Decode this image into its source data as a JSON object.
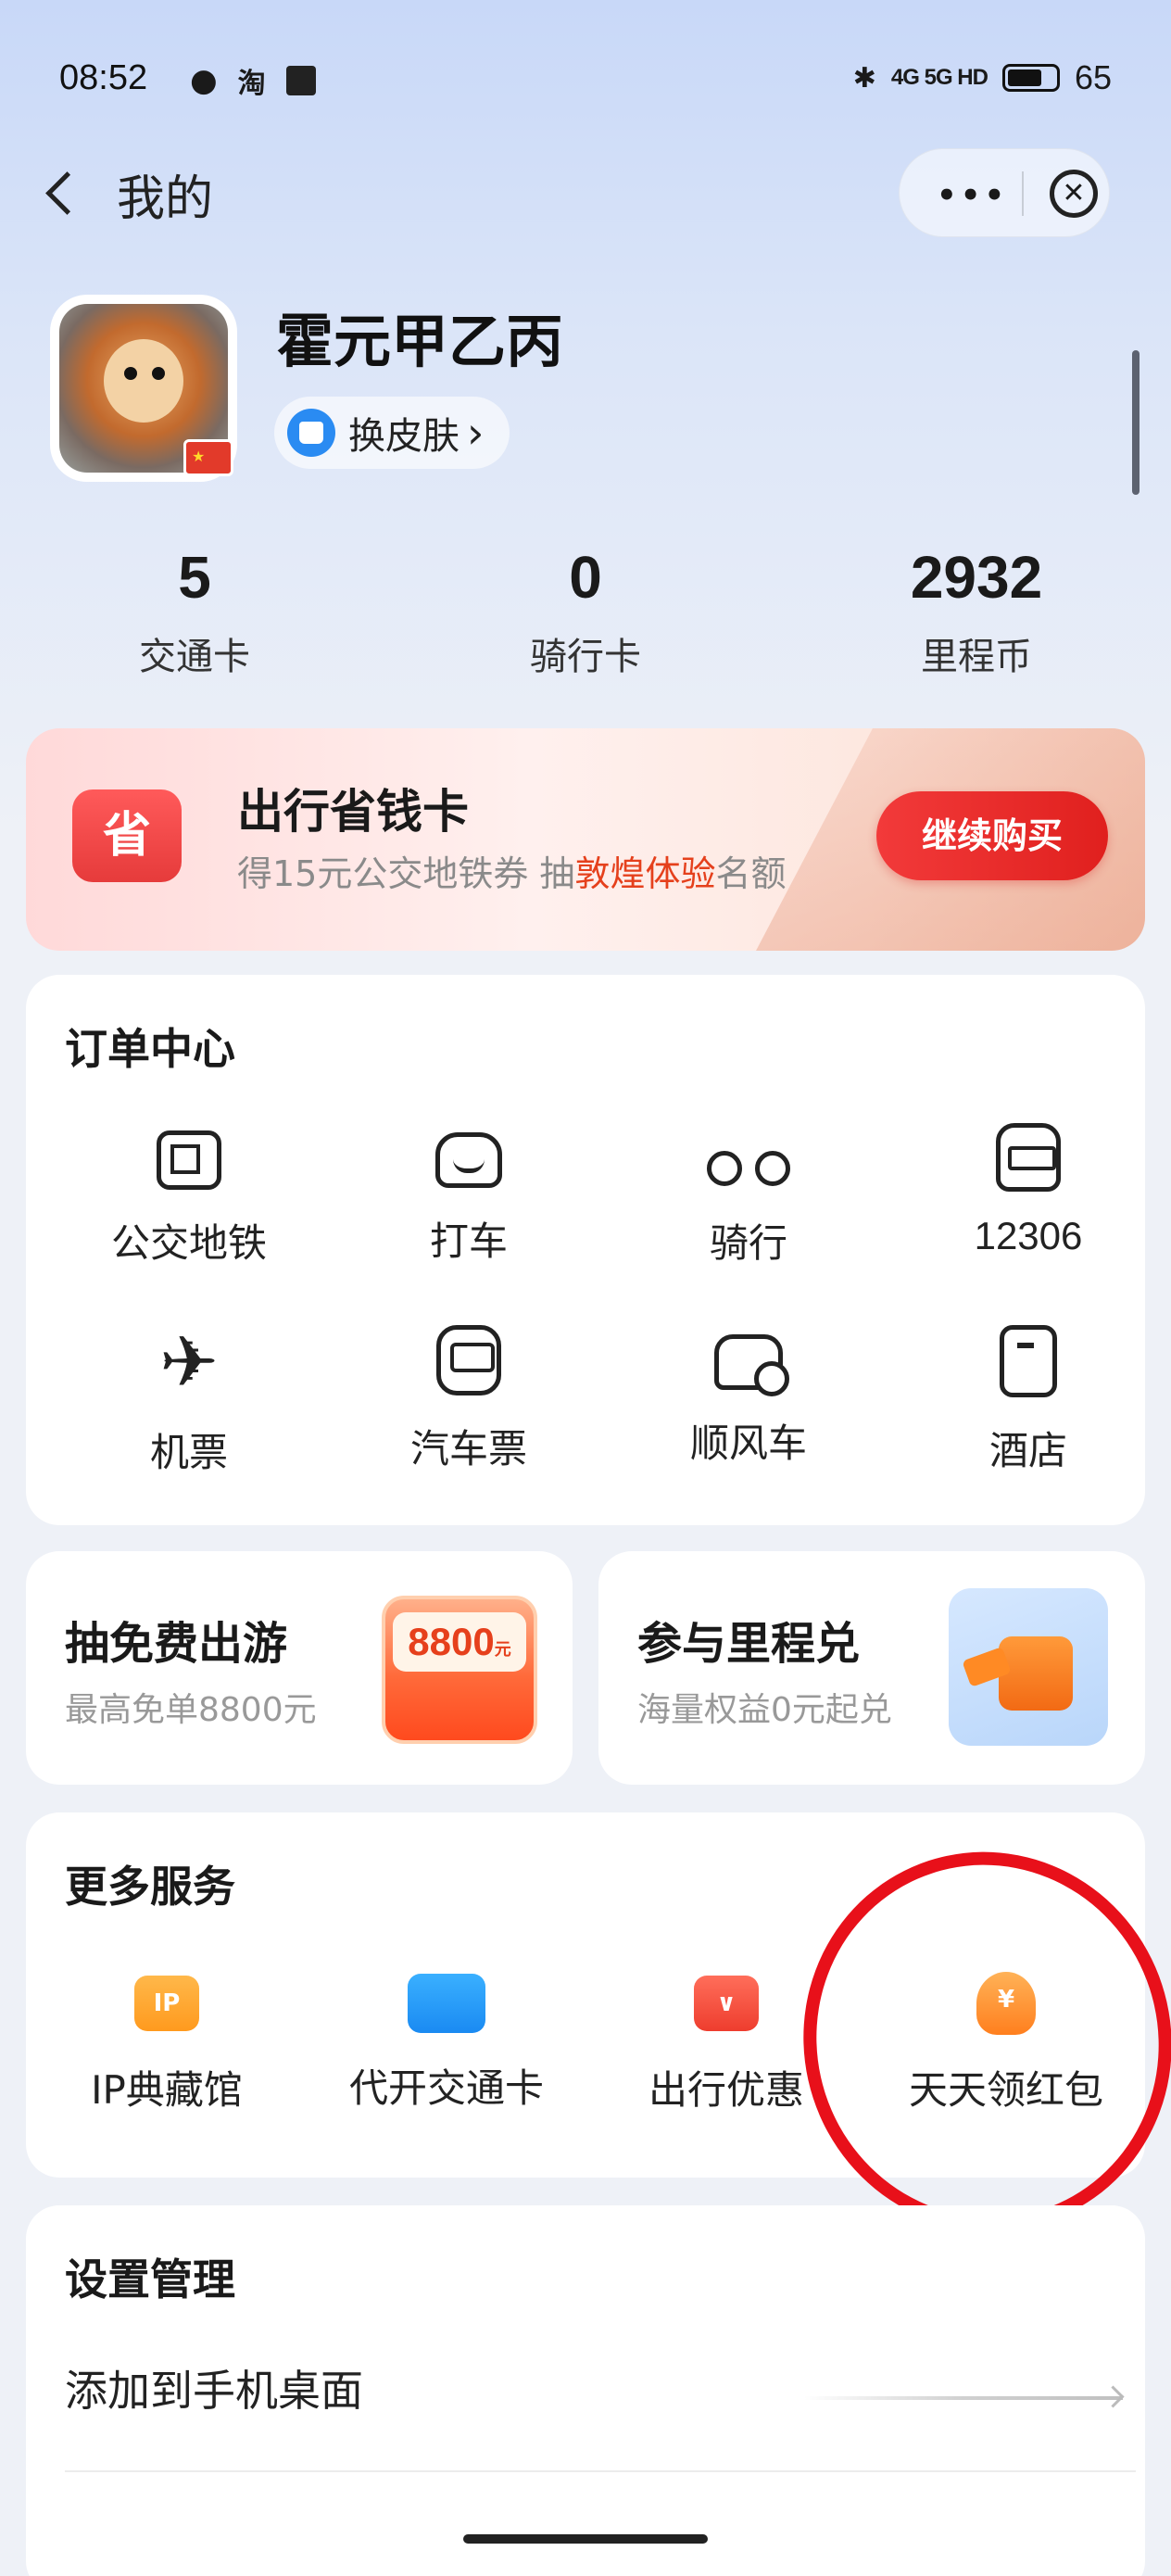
{
  "status_bar": {
    "time": "08:52",
    "left_icons": [
      "wechat-icon",
      "taobao-icon",
      "app-icon"
    ],
    "network": "4G 5G HD",
    "battery": "65"
  },
  "nav": {
    "title": "我的",
    "more": "•••",
    "close": "✕"
  },
  "profile": {
    "name": "霍元甲乙丙",
    "skin_button": "换皮肤",
    "skin_arrow": "›"
  },
  "stats": [
    {
      "value": "5",
      "label": "交通卡"
    },
    {
      "value": "0",
      "label": "骑行卡"
    },
    {
      "value": "2932",
      "label": "里程币"
    }
  ],
  "promo": {
    "icon_text": "省",
    "title": "出行省钱卡",
    "sub_prefix": "得15元公交地铁券 抽",
    "sub_highlight": "敦煌体验",
    "sub_suffix": "名额",
    "button": "继续购买",
    "highlight_color": "#e5401c"
  },
  "orders": {
    "title": "订单中心",
    "items": [
      {
        "label": "公交地铁",
        "icon": "bus-metro-icon"
      },
      {
        "label": "打车",
        "icon": "taxi-icon"
      },
      {
        "label": "骑行",
        "icon": "bike-icon"
      },
      {
        "label": "12306",
        "icon": "train-icon"
      },
      {
        "label": "机票",
        "icon": "plane-icon"
      },
      {
        "label": "汽车票",
        "icon": "coach-icon"
      },
      {
        "label": "顺风车",
        "icon": "carpool-icon"
      },
      {
        "label": "酒店",
        "icon": "hotel-icon"
      }
    ]
  },
  "lottery_card": {
    "title": "抽免费出游",
    "sub": "最高免单8800元",
    "badge": "8800",
    "badge_unit": "元"
  },
  "mileage_card": {
    "title": "参与里程兑",
    "sub": "海量权益0元起兑"
  },
  "more_services": {
    "title": "更多服务",
    "items": [
      {
        "label": "IP典藏馆",
        "icon": "ip-icon",
        "icon_text": "IP"
      },
      {
        "label": "代开交通卡",
        "icon": "transit-card-icon",
        "icon_text": ""
      },
      {
        "label": "出行优惠",
        "icon": "gift-icon",
        "icon_text": "∨"
      },
      {
        "label": "天天领红包",
        "icon": "money-bag-icon",
        "icon_text": "¥"
      }
    ]
  },
  "settings": {
    "title": "设置管理",
    "rows": [
      {
        "label": "添加到手机桌面"
      }
    ]
  }
}
